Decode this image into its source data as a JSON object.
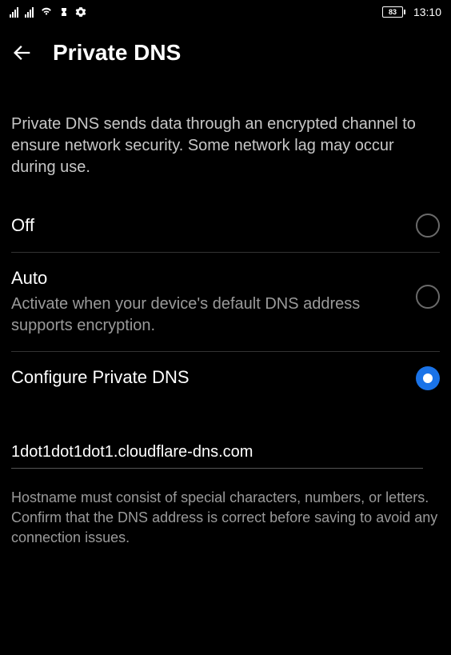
{
  "statusbar": {
    "battery": "83",
    "time": "13:10"
  },
  "header": {
    "title": "Private DNS"
  },
  "description": "Private DNS sends data through an encrypted channel to ensure network security. Some network lag may occur during use.",
  "options": {
    "off": {
      "label": "Off"
    },
    "auto": {
      "label": "Auto",
      "sublabel": "Activate when your device's default DNS address supports encryption."
    },
    "configure": {
      "label": "Configure Private DNS"
    }
  },
  "dns": {
    "value": "1dot1dot1dot1.cloudflare-dns.com"
  },
  "hostname_hint": "Hostname must consist of special characters, numbers, or letters. Confirm that the DNS address is correct before saving to avoid any connection issues."
}
